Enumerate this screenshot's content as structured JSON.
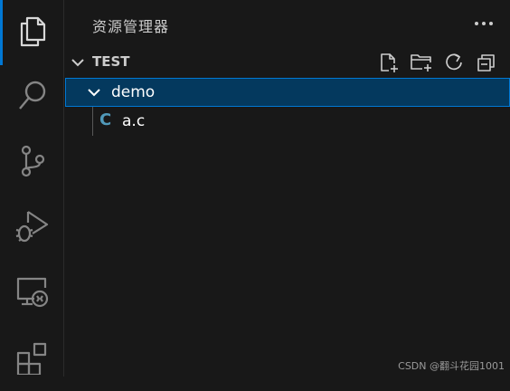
{
  "colors": {
    "accent": "#0078d4",
    "selection_bg": "#04395e",
    "c_icon": "#519aba"
  },
  "activity_bar": {
    "items": [
      {
        "icon": "files-icon",
        "active": true
      },
      {
        "icon": "search-icon",
        "active": false
      },
      {
        "icon": "source-control-icon",
        "active": false
      },
      {
        "icon": "run-debug-icon",
        "active": false
      },
      {
        "icon": "remote-explorer-icon",
        "active": false
      },
      {
        "icon": "extensions-icon",
        "active": false
      }
    ]
  },
  "sidebar": {
    "title": "资源管理器",
    "more_actions_icon": "ellipsis-icon",
    "section": {
      "title": "TEST",
      "actions": [
        "new-file-icon",
        "new-folder-icon",
        "refresh-icon",
        "collapse-all-icon"
      ]
    },
    "tree": [
      {
        "label": "demo",
        "type": "folder",
        "expanded": true,
        "selected": true
      },
      {
        "label": "a.c",
        "type": "file",
        "icon_letter": "C"
      }
    ]
  },
  "watermark": "CSDN @翻斗花园1001"
}
